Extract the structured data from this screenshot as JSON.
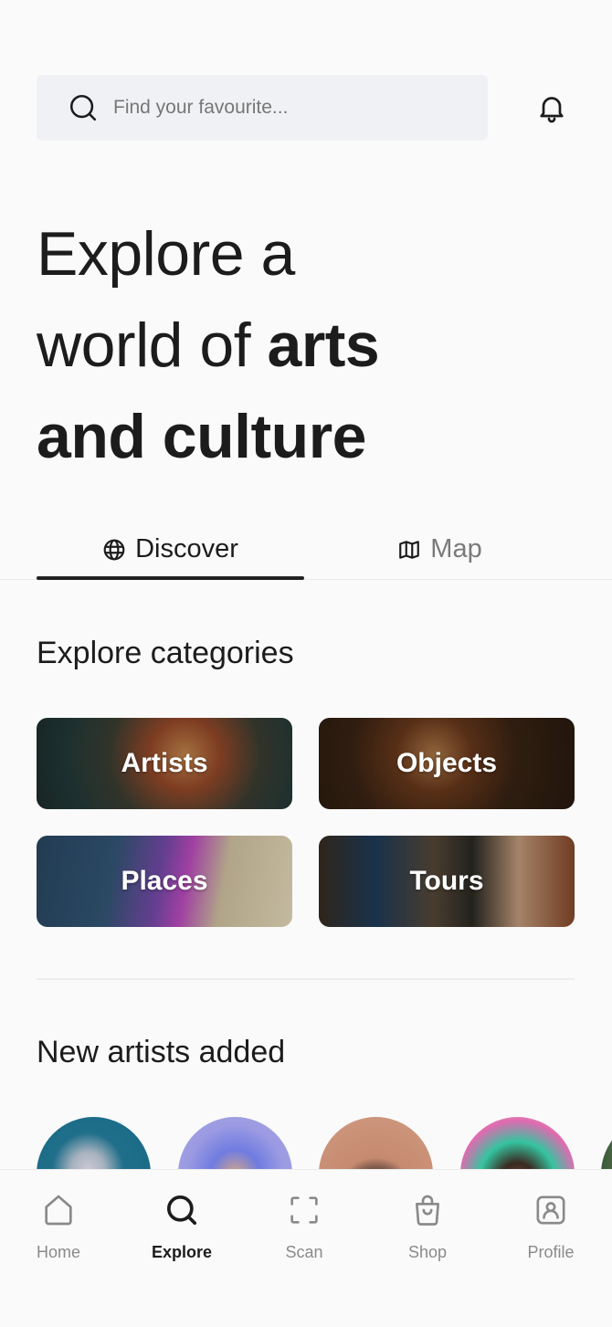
{
  "search": {
    "placeholder": "Find your favourite...",
    "value": "",
    "icon": "search-icon"
  },
  "header": {
    "notification_icon": "bell-icon"
  },
  "hero": {
    "line1": "Explore a",
    "line2_light": "world of ",
    "line2_bold": "arts",
    "line3_bold": "and culture"
  },
  "tabs": [
    {
      "label": "Discover",
      "icon": "globe-icon",
      "active": true
    },
    {
      "label": "Map",
      "icon": "map-icon",
      "active": false
    }
  ],
  "categories": {
    "title": "Explore categories",
    "items": [
      {
        "label": "Artists"
      },
      {
        "label": "Objects"
      },
      {
        "label": "Places"
      },
      {
        "label": "Tours"
      }
    ]
  },
  "new_artists": {
    "title": "New artists added",
    "count_visible": 5
  },
  "bottom_nav": [
    {
      "label": "Home",
      "icon": "home-icon",
      "active": false
    },
    {
      "label": "Explore",
      "icon": "search-icon",
      "active": true
    },
    {
      "label": "Scan",
      "icon": "scan-icon",
      "active": false
    },
    {
      "label": "Shop",
      "icon": "shopping-bag-icon",
      "active": false
    },
    {
      "label": "Profile",
      "icon": "profile-icon",
      "active": false
    }
  ],
  "colors": {
    "background": "#fafafa",
    "text_primary": "#1c1c1c",
    "text_muted": "#8a8a8a",
    "search_bg": "#f0f1f4"
  }
}
